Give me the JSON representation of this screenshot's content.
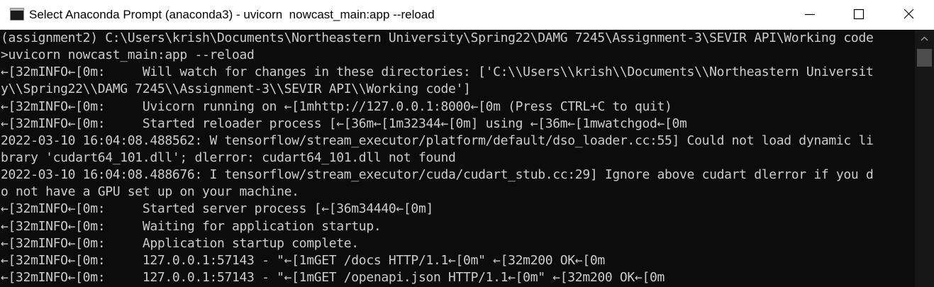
{
  "window": {
    "title": "Select Anaconda Prompt (anaconda3) - uvicorn  nowcast_main:app --reload",
    "icon": "console-icon",
    "controls": [
      "minimize",
      "maximize",
      "close"
    ]
  },
  "console": {
    "lines": [
      "(assignment2) C:\\Users\\krish\\Documents\\Northeastern University\\Spring22\\DAMG 7245\\Assignment-3\\SEVIR API\\Working code",
      ">uvicorn nowcast_main:app --reload",
      "←[32mINFO←[0m:     Will watch for changes in these directories: ['C:\\\\Users\\\\krish\\\\Documents\\\\Northeastern Universit",
      "y\\\\Spring22\\\\DAMG 7245\\\\Assignment-3\\\\SEVIR API\\\\Working code']",
      "←[32mINFO←[0m:     Uvicorn running on ←[1mhttp://127.0.0.1:8000←[0m (Press CTRL+C to quit)",
      "←[32mINFO←[0m:     Started reloader process [←[36m←[1m32344←[0m] using ←[36m←[1mwatchgod←[0m",
      "2022-03-10 16:04:08.488562: W tensorflow/stream_executor/platform/default/dso_loader.cc:55] Could not load dynamic li",
      "brary 'cudart64_101.dll'; dlerror: cudart64_101.dll not found",
      "2022-03-10 16:04:08.488676: I tensorflow/stream_executor/cuda/cudart_stub.cc:29] Ignore above cudart dlerror if you d",
      "o not have a GPU set up on your machine.",
      "←[32mINFO←[0m:     Started server process [←[36m34440←[0m]",
      "←[32mINFO←[0m:     Waiting for application startup.",
      "←[32mINFO←[0m:     Application startup complete.",
      "←[32mINFO←[0m:     127.0.0.1:57143 - \"←[1mGET /docs HTTP/1.1←[0m\" ←[32m200 OK←[0m",
      "←[32mINFO←[0m:     127.0.0.1:57143 - \"←[1mGET /openapi.json HTTP/1.1←[0m\" ←[32m200 OK←[0m"
    ]
  },
  "colors": {
    "console_bg": "#0c0c0c",
    "console_text": "#cccccc",
    "titlebar_bg": "#ffffff"
  }
}
